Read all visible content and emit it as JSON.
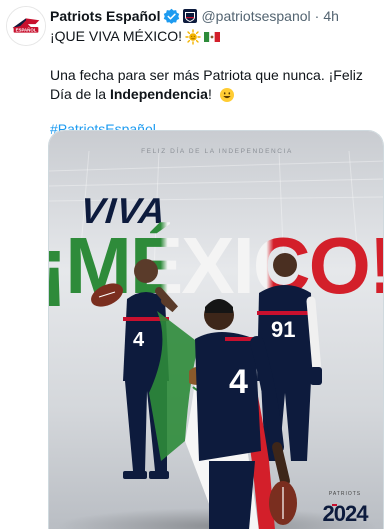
{
  "author": {
    "name": "Patriots Español",
    "handle": "@patriotsespanol",
    "separator": "·",
    "time": "4h"
  },
  "tweet": {
    "line1": "¡QUE VIVA MÉXICO!",
    "para2_prefix": "Una fecha para ser más Patriota que nunca. ¡Feliz Día de la ",
    "para2_bold": "Independencia",
    "para2_suffix": "!",
    "hashtag": "#PatriotsEspañol"
  },
  "media": {
    "top_caption": "FELIZ DÍA DE LA INDEPENDENCIA",
    "headline_1": "VIVA",
    "headline_2": "¡MÉXICO!",
    "jersey_numbers": [
      "4",
      "91",
      "4"
    ],
    "season_label": "PATRIOTS",
    "season_year": "2024"
  },
  "colors": {
    "link": "#1d9bf0",
    "text": "#0f1419",
    "muted": "#536471",
    "verified": "#1d9bf0",
    "flag_green": "#2e8b3a",
    "flag_red": "#d31f2a",
    "navy": "#0d1b3d"
  },
  "icons": [
    "patriots-logo-icon",
    "verified-icon",
    "nfl-badge-icon",
    "sun-emoji-icon",
    "mexico-flag-emoji-icon",
    "smile-emoji-icon"
  ]
}
